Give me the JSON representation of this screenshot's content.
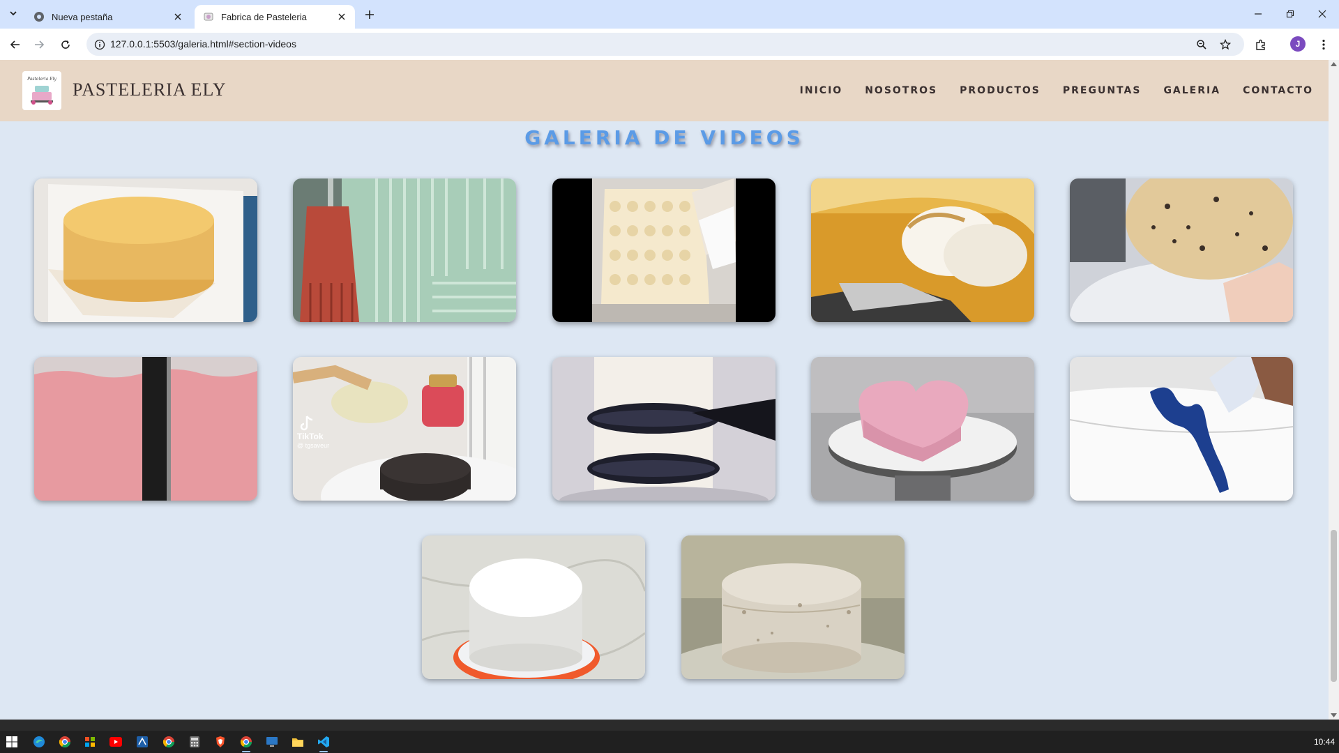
{
  "browser": {
    "tabs": [
      {
        "title": "Nueva pestaña",
        "icon": "chrome-icon",
        "active": false
      },
      {
        "title": "Fabrica de Pasteleria",
        "icon": "page-favicon",
        "active": true
      }
    ],
    "url": "127.0.0.1:5503/galeria.html#section-videos",
    "profile_initial": "J"
  },
  "site": {
    "brand": "PASTELERIA ELY",
    "logo_text": "Pasteleria Ely",
    "nav": [
      "INICIO",
      "NOSOTROS",
      "PRODUCTOS",
      "PREGUNTAS",
      "GALERIA",
      "CONTACTO"
    ]
  },
  "gallery": {
    "title": "GALERIA DE VIDEOS",
    "videos": [
      {
        "subject": "yellow sponge cake on paper"
      },
      {
        "subject": "red brush painting green textured cake"
      },
      {
        "subject": "piping buttercream ruffles"
      },
      {
        "subject": "torching meringue on lemon cake"
      },
      {
        "subject": "flipping chocolate chip sponge"
      },
      {
        "subject": "smoothing pink buttercream"
      },
      {
        "subject": "brushing syrup on chocolate sponge",
        "watermark_brand": "TikTok",
        "watermark_user": "@ tgsaveur"
      },
      {
        "subject": "piping black bows on white cake"
      },
      {
        "subject": "pink heart shaped cake"
      },
      {
        "subject": "piping blue wave on white cake"
      },
      {
        "subject": "white fondant cake on turntable"
      },
      {
        "subject": "naked rustic cake"
      }
    ]
  },
  "taskbar": {
    "time": "10:44",
    "apps": [
      "start",
      "edge",
      "chrome",
      "store",
      "youtube",
      "ide",
      "chrome",
      "calculator",
      "brave",
      "chrome",
      "remote-desktop",
      "file-explorer",
      "vscode"
    ]
  },
  "colors": {
    "tab_strip": "#d3e3fd",
    "page_bg": "#dde7f3",
    "header_bg": "#e8d7c6",
    "title": "#5b9be6",
    "taskbar": "#202020"
  }
}
